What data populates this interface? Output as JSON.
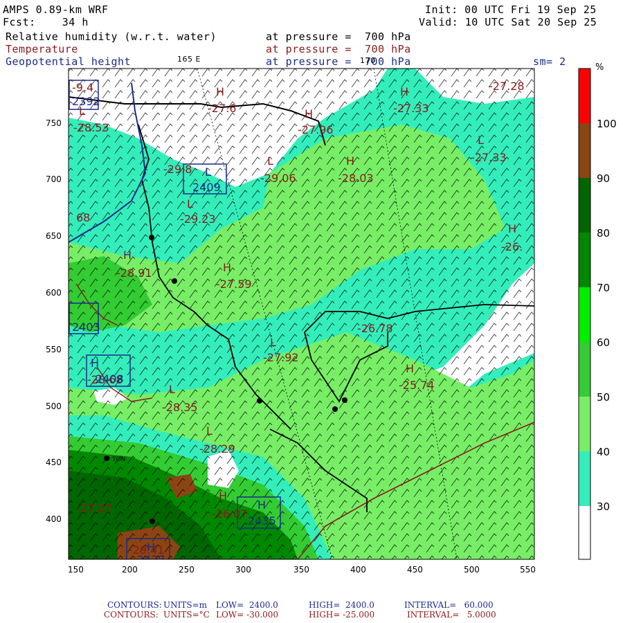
{
  "header": {
    "model": "AMPS 0.89-km WRF",
    "fcst": "Fcst:    34 h",
    "init": "Init: 00 UTC Fri 19 Sep 25",
    "valid": "Valid: 10 UTC Sat 20 Sep 25",
    "field1": "Relative humidity (w.r.t. water)",
    "field1_level": "at pressure =  700 hPa",
    "field2": "Temperature",
    "field2_level": "at pressure =  700 hPa",
    "field3": "Geopotential height",
    "field3_level": "at pressure =  700 hPa",
    "lon_label_1": "165 E",
    "lon_label_2": "170",
    "smoothing": "sm= 2"
  },
  "colors": {
    "white_band": "#ffffff",
    "aqua_band": "#33eebb",
    "light_green_band": "#77ee66",
    "green_band": "#33cc33",
    "bright_green_band": "#00ee00",
    "dark_green_band": "#008800",
    "darker_green_band": "#006600",
    "brown_band": "#8b4513",
    "red_band": "#ff0000",
    "temperature_contour": "#8b1a1a",
    "height_contour": "#1a2a8c"
  },
  "colorbar": {
    "unit": "%",
    "labels": [
      "100",
      "90",
      "80",
      "70",
      "60",
      "50",
      "40",
      "30"
    ]
  },
  "axes": {
    "x_ticks": [
      "150",
      "200",
      "250",
      "300",
      "350",
      "400",
      "450",
      "500",
      "550"
    ],
    "y_ticks": [
      "750",
      "700",
      "650",
      "600",
      "550",
      "500",
      "450",
      "400"
    ]
  },
  "temperature_labels": [
    {
      "t": "H",
      "v": "-27.6"
    },
    {
      "t": "H",
      "v": "-27.33"
    },
    {
      "t": "H",
      "v": "-27.28"
    },
    {
      "t": "H",
      "v": "-27.96"
    },
    {
      "t": "L",
      "v": "-28.53"
    },
    {
      "t": "L",
      "v": "-29.8"
    },
    {
      "t": "L",
      "v": "-29.06"
    },
    {
      "t": "H",
      "v": "-28.03"
    },
    {
      "t": "L",
      "v": "-27.33"
    },
    {
      "t": "L",
      "v": "-29.23"
    },
    {
      "t": "H",
      "v": "-26."
    },
    {
      "t": "H",
      "v": "-28.91"
    },
    {
      "t": "H",
      "v": "-27.59"
    },
    {
      "t": "",
      "v": "-26.78"
    },
    {
      "t": "L",
      "v": "-27.92"
    },
    {
      "t": "H",
      "v": "-25.74"
    },
    {
      "t": "L",
      "v": "-28.35"
    },
    {
      "t": "L",
      "v": "-28.29"
    },
    {
      "t": "L",
      "v": "-27.27"
    },
    {
      "t": "H",
      "v": "-26.07"
    },
    {
      "t": "L",
      "v": "-29.41"
    },
    {
      "t": "L",
      "v": "-28.68"
    },
    {
      "t": "",
      "v": "-9.4"
    },
    {
      "t": "",
      "v": "68"
    }
  ],
  "height_labels": [
    {
      "t": "L",
      "v": "2409"
    },
    {
      "t": "",
      "v": "2392"
    },
    {
      "t": "",
      "v": "2403"
    },
    {
      "t": "H",
      "v": "2408"
    },
    {
      "t": "H",
      "v": "2435"
    },
    {
      "t": "H",
      "v": "2427"
    }
  ],
  "station_label": "TON",
  "footer": {
    "line1_label": "CONTOURS:",
    "line1_units": "UNITS=m",
    "line1_low": "LOW=  2400.0",
    "line1_high": "HIGH=  2400.0",
    "line1_interval": "INTERVAL=   60.000",
    "line2_label": "CONTOURS:",
    "line2_units": "UNITS=°C",
    "line2_low": "LOW= -30.000",
    "line2_high": "HIGH= -25.000",
    "line2_interval": "INTERVAL=   5.0000"
  }
}
